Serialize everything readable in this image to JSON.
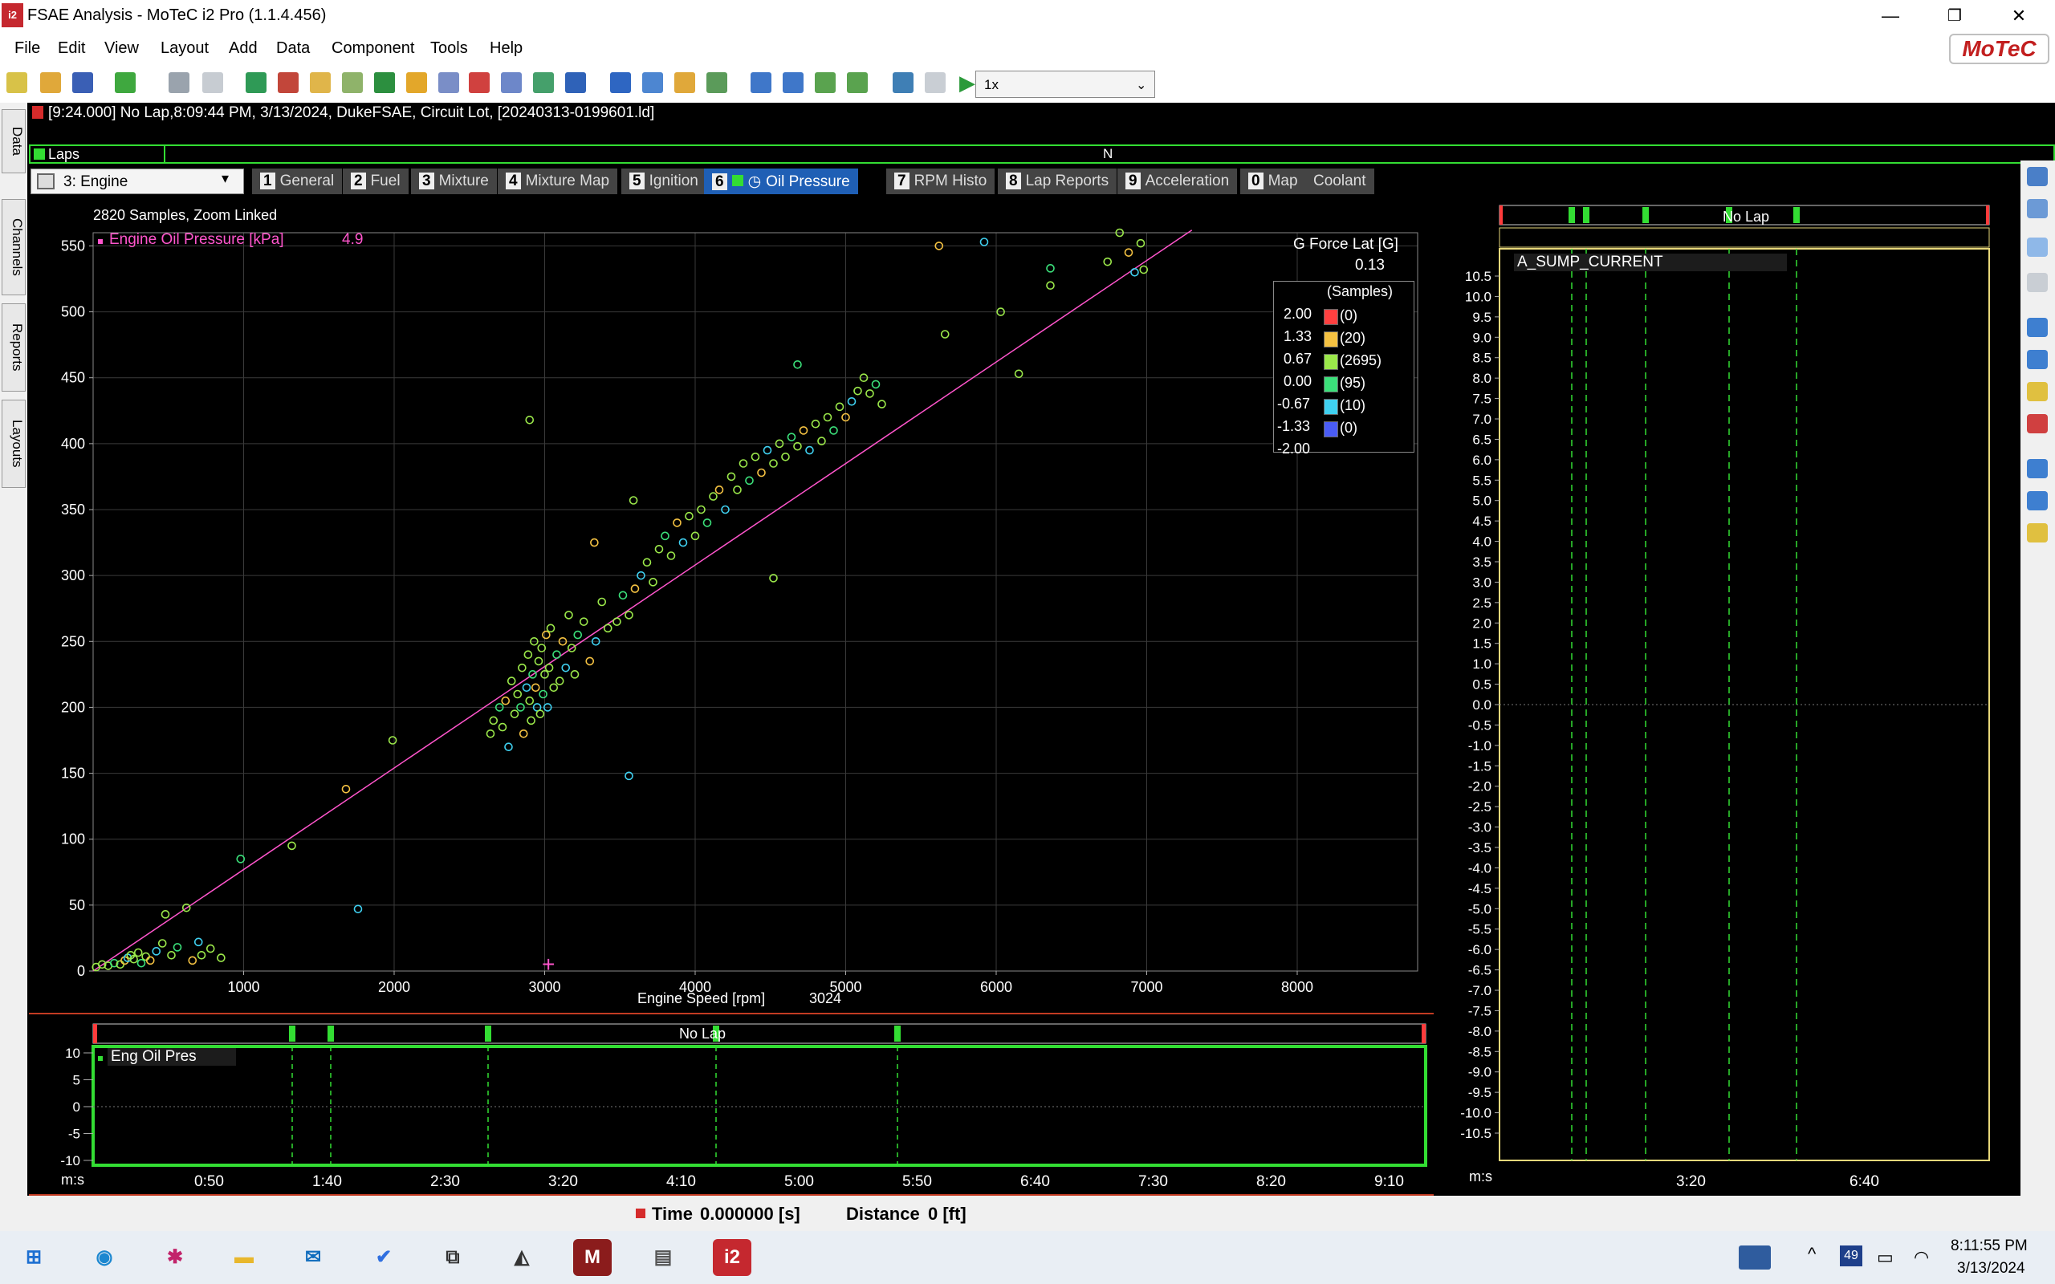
{
  "app": {
    "icon_text": "i2",
    "title": "FSAE Analysis - MoTeC i2 Pro (1.1.4.456)",
    "logo": "MoTeC"
  },
  "window_controls": {
    "minimize": "—",
    "restore": "❐",
    "close": "✕"
  },
  "menu": [
    "File",
    "Edit",
    "View",
    "Layout",
    "Add",
    "Data",
    "Component",
    "Tools",
    "Help"
  ],
  "toolbar": {
    "playback_speed": "1x"
  },
  "info_bar": "[9:24.000] No Lap,8:09:44 PM, 3/13/2024,  DukeFSAE, Circuit Lot,  [20240313-0199601.ld]",
  "left_tabs": [
    "Data",
    "Channels",
    "Reports",
    "Layouts"
  ],
  "laps": {
    "label": "Laps",
    "marker": "N"
  },
  "worksheet": {
    "select": "3: Engine",
    "tabs": [
      {
        "num": "1",
        "label": "General"
      },
      {
        "num": "2",
        "label": "Fuel"
      },
      {
        "num": "3",
        "label": "Mixture"
      },
      {
        "num": "4",
        "label": "Mixture Map"
      },
      {
        "num": "5",
        "label": "Ignition"
      },
      {
        "num": "6",
        "label": "Oil Pressure"
      },
      {
        "num": "7",
        "label": "RPM Histo"
      },
      {
        "num": "8",
        "label": "Lap Reports"
      },
      {
        "num": "9",
        "label": "Acceleration"
      },
      {
        "num": "0",
        "label": "Map"
      },
      {
        "num": "",
        "label": "Coolant"
      }
    ],
    "active": "Oil Pressure"
  },
  "scatter": {
    "samples_text": "2820 Samples, Zoom Linked",
    "y_channel": "Engine Oil Pressure [kPa]",
    "y_value": "4.9",
    "x_channel": "Engine Speed [rpm]",
    "x_value": "3024",
    "color_channel": "G Force Lat [G]",
    "color_value": "0.13",
    "legend_title": "(Samples)",
    "legend": [
      {
        "level": "2.00",
        "count": "(0)",
        "color": "#ff4040"
      },
      {
        "level": "1.33",
        "count": "(20)",
        "color": "#f5c242"
      },
      {
        "level": "0.67",
        "count": "(2695)",
        "color": "#9be84a"
      },
      {
        "level": "0.00",
        "count": "(95)",
        "color": "#3be07a"
      },
      {
        "level": "-0.67",
        "count": "(10)",
        "color": "#3fd0f0"
      },
      {
        "level": "-1.33",
        "count": "(0)",
        "color": "#4a5cf5"
      },
      {
        "level": "-2.00",
        "count": "",
        "color": ""
      }
    ]
  },
  "right_panel": {
    "lap_label": "No Lap",
    "channel": "A_SUMP_CURRENT",
    "y_ticks": [
      "10.5",
      "10.0",
      "9.5",
      "9.0",
      "8.5",
      "8.0",
      "7.5",
      "7.0",
      "6.5",
      "6.0",
      "5.5",
      "5.0",
      "4.5",
      "4.0",
      "3.5",
      "3.0",
      "2.5",
      "2.0",
      "1.5",
      "1.0",
      "0.5",
      "0.0",
      "-0.5",
      "-1.0",
      "-1.5",
      "-2.0",
      "-2.5",
      "-3.0",
      "-3.5",
      "-4.0",
      "-4.5",
      "-5.0",
      "-5.5",
      "-6.0",
      "-6.5",
      "-7.0",
      "-7.5",
      "-8.0",
      "-8.5",
      "-9.0",
      "-9.5",
      "-10.0",
      "-10.5"
    ],
    "x_unit": "m:s",
    "x_ticks": [
      "3:20",
      "6:40"
    ]
  },
  "bottom_panel": {
    "lap_label": "No Lap",
    "channel": "Eng Oil Pres",
    "y_ticks": [
      "10",
      "5",
      "0",
      "-5",
      "-10"
    ],
    "x_unit": "m:s",
    "x_ticks": [
      "0:50",
      "1:40",
      "2:30",
      "3:20",
      "4:10",
      "5:00",
      "5:50",
      "6:40",
      "7:30",
      "8:20",
      "9:10"
    ]
  },
  "status": {
    "time_label": "Time",
    "time_value": "0.000000 [s]",
    "distance_label": "Distance",
    "distance_value": "0 [ft]"
  },
  "taskbar": {
    "badge": "49",
    "time": "8:11:55 PM",
    "date": "3/13/2024"
  },
  "colors": {
    "accent_tab": "#1f5fb5",
    "plot_grid": "#3a3a3a",
    "lap_marker": "#33dd33",
    "fit_line": "#ff55cc",
    "panel_border": "#c23b22"
  },
  "chart_data": [
    {
      "type": "scatter",
      "title": "",
      "xlabel": "Engine Speed [rpm]",
      "ylabel": "Engine Oil Pressure [kPa]",
      "xlim": [
        0,
        8800
      ],
      "ylim": [
        0,
        560
      ],
      "x_ticks": [
        1000,
        2000,
        3000,
        4000,
        5000,
        6000,
        7000,
        8000
      ],
      "y_ticks": [
        0,
        50,
        100,
        150,
        200,
        250,
        300,
        350,
        400,
        450,
        500,
        550
      ],
      "fit_line": {
        "x": [
          0,
          7300
        ],
        "y": [
          0,
          562
        ]
      },
      "cursor": {
        "x": 3024,
        "y": 4.9
      },
      "points": [
        [
          20,
          3
        ],
        [
          60,
          5
        ],
        [
          100,
          4
        ],
        [
          140,
          6
        ],
        [
          180,
          5
        ],
        [
          210,
          8
        ],
        [
          230,
          10
        ],
        [
          250,
          12
        ],
        [
          270,
          9
        ],
        [
          300,
          14
        ],
        [
          320,
          6
        ],
        [
          350,
          11
        ],
        [
          380,
          8
        ],
        [
          420,
          15
        ],
        [
          460,
          21
        ],
        [
          480,
          43
        ],
        [
          520,
          12
        ],
        [
          560,
          18
        ],
        [
          620,
          48
        ],
        [
          660,
          8
        ],
        [
          700,
          22
        ],
        [
          720,
          12
        ],
        [
          780,
          17
        ],
        [
          850,
          10
        ],
        [
          980,
          85
        ],
        [
          1320,
          95
        ],
        [
          1680,
          138
        ],
        [
          1760,
          47
        ],
        [
          1990,
          175
        ],
        [
          2640,
          180
        ],
        [
          2660,
          190
        ],
        [
          2700,
          200
        ],
        [
          2720,
          185
        ],
        [
          2740,
          205
        ],
        [
          2760,
          170
        ],
        [
          2780,
          220
        ],
        [
          2800,
          195
        ],
        [
          2820,
          210
        ],
        [
          2840,
          200
        ],
        [
          2850,
          230
        ],
        [
          2860,
          180
        ],
        [
          2880,
          215
        ],
        [
          2890,
          240
        ],
        [
          2900,
          205
        ],
        [
          2910,
          190
        ],
        [
          2920,
          225
        ],
        [
          2930,
          250
        ],
        [
          2940,
          215
        ],
        [
          2950,
          200
        ],
        [
          2960,
          235
        ],
        [
          2970,
          195
        ],
        [
          2980,
          245
        ],
        [
          2990,
          210
        ],
        [
          3000,
          225
        ],
        [
          3010,
          255
        ],
        [
          3020,
          200
        ],
        [
          3030,
          230
        ],
        [
          3040,
          260
        ],
        [
          3060,
          215
        ],
        [
          3080,
          240
        ],
        [
          3100,
          220
        ],
        [
          3120,
          250
        ],
        [
          3140,
          230
        ],
        [
          3160,
          270
        ],
        [
          3180,
          245
        ],
        [
          3200,
          225
        ],
        [
          3220,
          255
        ],
        [
          3260,
          265
        ],
        [
          3300,
          235
        ],
        [
          3340,
          250
        ],
        [
          3380,
          280
        ],
        [
          3420,
          260
        ],
        [
          3480,
          265
        ],
        [
          3520,
          285
        ],
        [
          3560,
          270
        ],
        [
          3600,
          290
        ],
        [
          3640,
          300
        ],
        [
          3680,
          310
        ],
        [
          3720,
          295
        ],
        [
          3760,
          320
        ],
        [
          3800,
          330
        ],
        [
          3840,
          315
        ],
        [
          3880,
          340
        ],
        [
          3920,
          325
        ],
        [
          3960,
          345
        ],
        [
          4000,
          330
        ],
        [
          4040,
          350
        ],
        [
          4080,
          340
        ],
        [
          4120,
          360
        ],
        [
          4160,
          365
        ],
        [
          4200,
          350
        ],
        [
          4240,
          375
        ],
        [
          4280,
          365
        ],
        [
          4320,
          385
        ],
        [
          4360,
          372
        ],
        [
          4400,
          390
        ],
        [
          4440,
          378
        ],
        [
          4480,
          395
        ],
        [
          4520,
          385
        ],
        [
          4560,
          400
        ],
        [
          4600,
          390
        ],
        [
          4640,
          405
        ],
        [
          4680,
          398
        ],
        [
          4720,
          410
        ],
        [
          4760,
          395
        ],
        [
          4800,
          415
        ],
        [
          4840,
          402
        ],
        [
          4880,
          420
        ],
        [
          4920,
          410
        ],
        [
          4960,
          428
        ],
        [
          5000,
          420
        ],
        [
          5040,
          432
        ],
        [
          5080,
          440
        ],
        [
          5120,
          450
        ],
        [
          5160,
          438
        ],
        [
          5200,
          445
        ],
        [
          5240,
          430
        ],
        [
          3330,
          325
        ],
        [
          3560,
          148
        ],
        [
          3590,
          357
        ],
        [
          2900,
          418
        ],
        [
          4520,
          298
        ],
        [
          4680,
          460
        ],
        [
          5660,
          483
        ],
        [
          5620,
          550
        ],
        [
          5920,
          553
        ],
        [
          6030,
          500
        ],
        [
          6150,
          453
        ],
        [
          6360,
          520
        ],
        [
          6360,
          533
        ],
        [
          6820,
          560
        ],
        [
          6880,
          545
        ],
        [
          6920,
          530
        ],
        [
          6960,
          552
        ],
        [
          6980,
          532
        ],
        [
          6740,
          538
        ]
      ]
    },
    {
      "type": "line",
      "title": "",
      "series": [
        {
          "name": "A_SUMP_CURRENT",
          "values": []
        }
      ],
      "ylim": [
        -10.5,
        10.5
      ]
    },
    {
      "type": "line",
      "title": "",
      "series": [
        {
          "name": "Eng Oil Pres",
          "values": []
        }
      ],
      "ylim": [
        -10,
        10
      ]
    }
  ]
}
